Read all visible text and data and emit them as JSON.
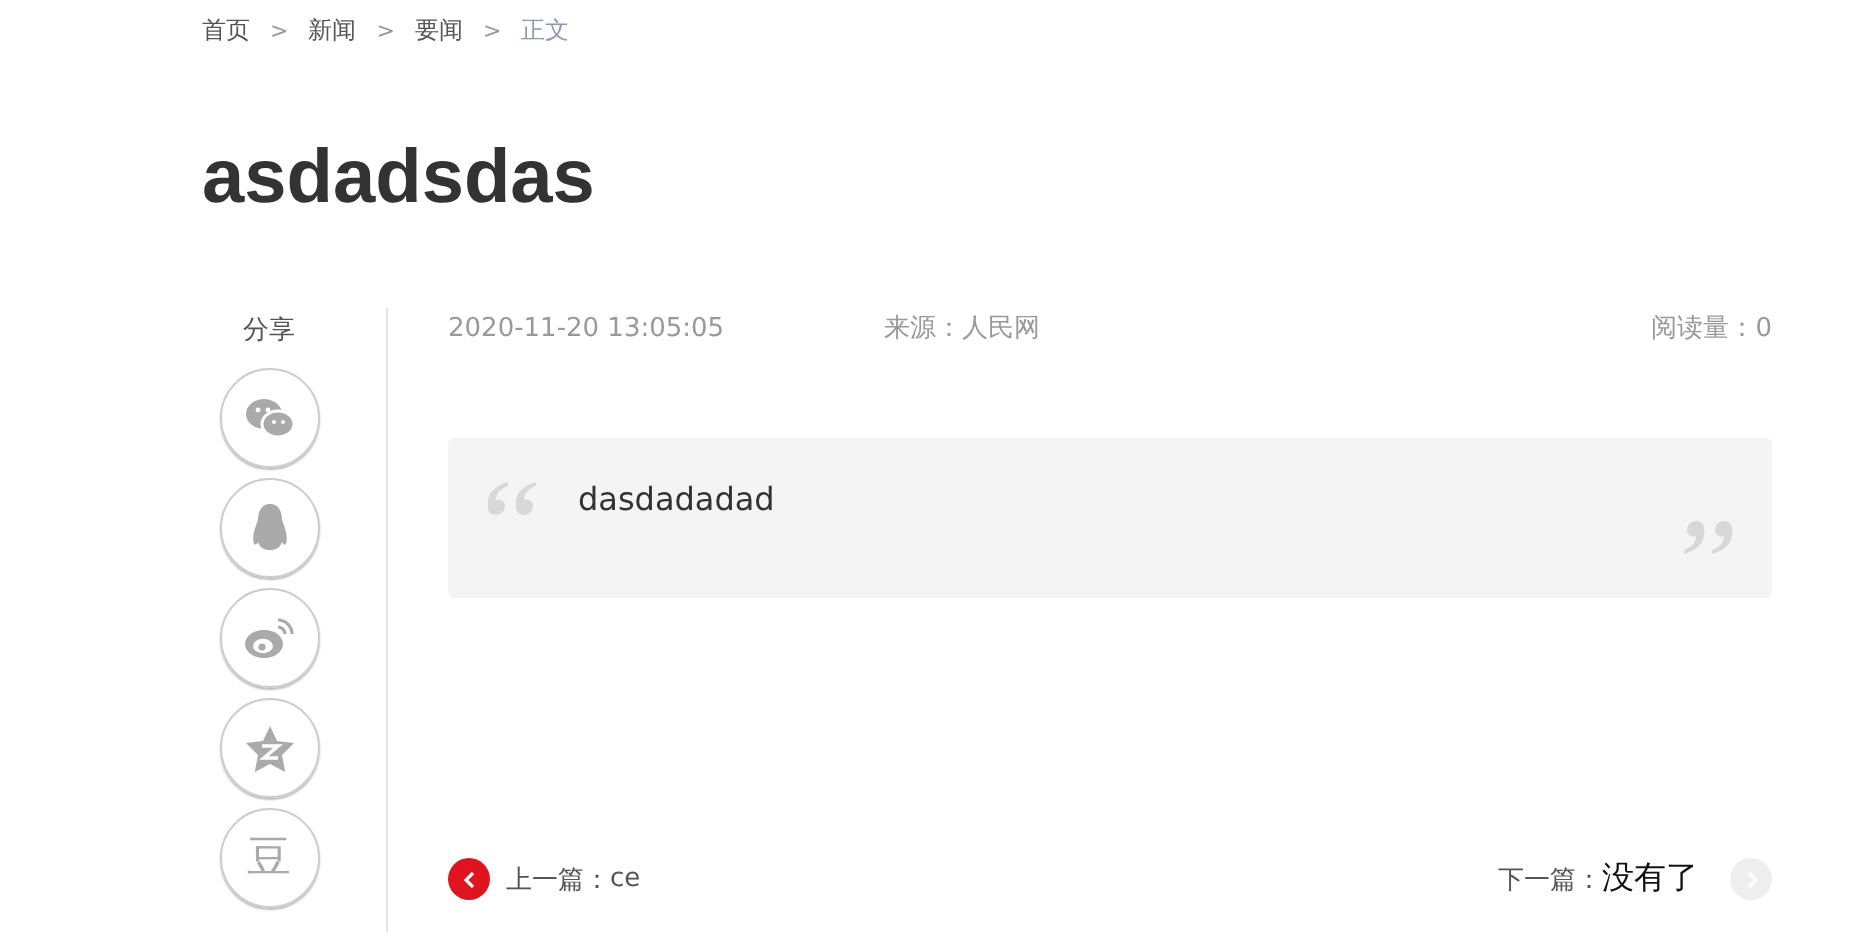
{
  "breadcrumb": [
    {
      "label": "首页",
      "current": false
    },
    {
      "label": "新闻",
      "current": false
    },
    {
      "label": "要闻",
      "current": false
    },
    {
      "label": "正文",
      "current": true
    }
  ],
  "separator": ">",
  "title": "asdadsdas",
  "share": {
    "label": "分享",
    "items": [
      {
        "kind": "wechat"
      },
      {
        "kind": "qq"
      },
      {
        "kind": "weibo"
      },
      {
        "kind": "qzone"
      },
      {
        "kind": "douban",
        "glyph": "豆"
      }
    ]
  },
  "meta": {
    "date": "2020-11-20 13:05:05",
    "source": "来源：人民网",
    "views": "阅读量：0"
  },
  "quote": "dasdadadad",
  "nav": {
    "prev": {
      "label": "上一篇：",
      "title": "ce",
      "disabled": false
    },
    "next": {
      "label": "下一篇：",
      "title": "没有了",
      "disabled": true
    }
  }
}
